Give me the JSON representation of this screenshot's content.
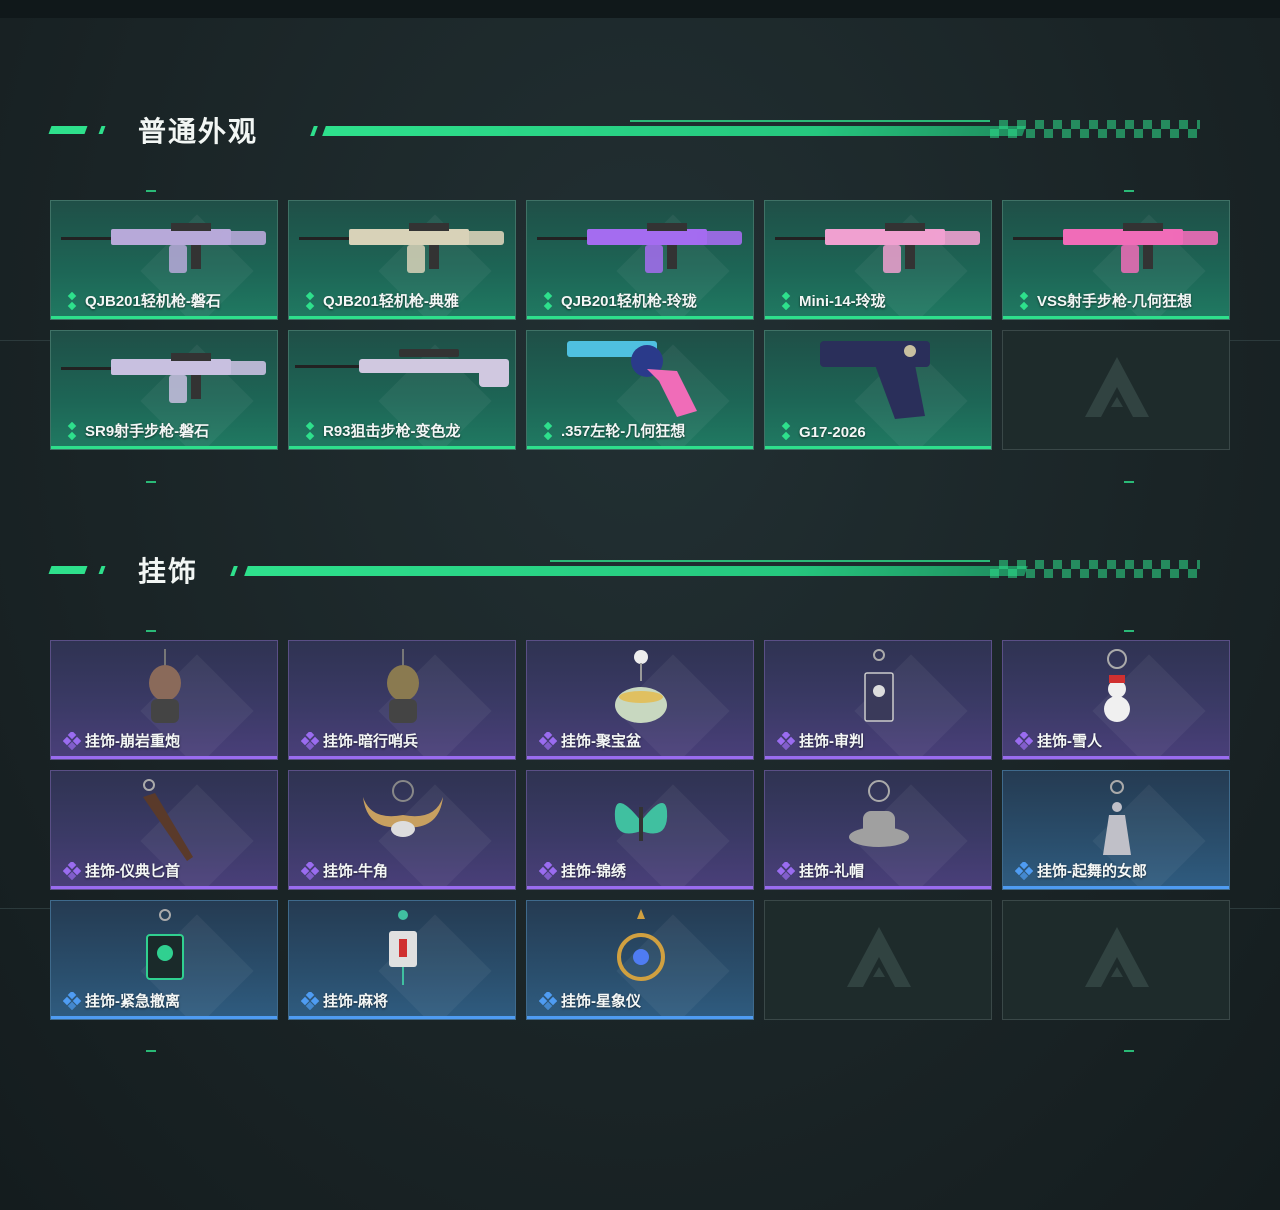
{
  "sections": [
    {
      "title": "普通外观",
      "items": [
        {
          "label": "QJB201轻机枪-磐石",
          "rarity": "green",
          "icon": "rifle-icon",
          "accent": "#b7a9d9"
        },
        {
          "label": "QJB201轻机枪-典雅",
          "rarity": "green",
          "icon": "rifle-icon",
          "accent": "#d8d2b8"
        },
        {
          "label": "QJB201轻机枪-玲珑",
          "rarity": "green",
          "icon": "rifle-icon",
          "accent": "#a46cf0"
        },
        {
          "label": "Mini-14-玲珑",
          "rarity": "green",
          "icon": "rifle-icon",
          "accent": "#f0a0d0"
        },
        {
          "label": "VSS射手步枪-几何狂想",
          "rarity": "green",
          "icon": "rifle-icon",
          "accent": "#f06cb8"
        },
        {
          "label": "SR9射手步枪-磐石",
          "rarity": "green",
          "icon": "rifle-icon",
          "accent": "#c8c0e0"
        },
        {
          "label": "R93狙击步枪-变色龙",
          "rarity": "green",
          "icon": "sniper-icon",
          "accent": "#d0c8e0"
        },
        {
          "label": ".357左轮-几何狂想",
          "rarity": "green",
          "icon": "revolver-icon",
          "accent": "#f06cb8"
        },
        {
          "label": "G17-2026",
          "rarity": "green",
          "icon": "pistol-icon",
          "accent": "#2a2f5a"
        },
        {
          "label": "",
          "rarity": "empty",
          "icon": "logo-icon",
          "accent": ""
        }
      ]
    },
    {
      "title": "挂饰",
      "items": [
        {
          "label": "挂饰-崩岩重炮",
          "rarity": "purple",
          "icon": "charm-figure-icon",
          "accent": "#8a6a5a"
        },
        {
          "label": "挂饰-暗行哨兵",
          "rarity": "purple",
          "icon": "charm-figure-icon",
          "accent": "#8a7a50"
        },
        {
          "label": "挂饰-聚宝盆",
          "rarity": "purple",
          "icon": "charm-bowl-icon",
          "accent": "#c8d8c0"
        },
        {
          "label": "挂饰-审判",
          "rarity": "purple",
          "icon": "charm-card-icon",
          "accent": "#3a3a5a"
        },
        {
          "label": "挂饰-雪人",
          "rarity": "purple",
          "icon": "charm-snowman-icon",
          "accent": "#f0f0f0"
        },
        {
          "label": "挂饰-仪典匕首",
          "rarity": "purple",
          "icon": "charm-dagger-icon",
          "accent": "#5a3a2a"
        },
        {
          "label": "挂饰-牛角",
          "rarity": "purple",
          "icon": "charm-horns-icon",
          "accent": "#c8a060"
        },
        {
          "label": "挂饰-锦绣",
          "rarity": "purple",
          "icon": "charm-butterfly-icon",
          "accent": "#40c0a0"
        },
        {
          "label": "挂饰-礼帽",
          "rarity": "purple",
          "icon": "charm-hat-icon",
          "accent": "#a0a0a0"
        },
        {
          "label": "挂饰-起舞的女郎",
          "rarity": "blue",
          "icon": "charm-dancer-icon",
          "accent": "#c0c0c8"
        },
        {
          "label": "挂饰-紧急撤离",
          "rarity": "blue",
          "icon": "charm-box-icon",
          "accent": "#30d090"
        },
        {
          "label": "挂饰-麻将",
          "rarity": "blue",
          "icon": "charm-mahjong-icon",
          "accent": "#e0e0e0"
        },
        {
          "label": "挂饰-星象仪",
          "rarity": "blue",
          "icon": "charm-astrolabe-icon",
          "accent": "#d0a040"
        },
        {
          "label": "",
          "rarity": "empty",
          "icon": "logo-icon",
          "accent": ""
        },
        {
          "label": "",
          "rarity": "empty",
          "icon": "logo-icon",
          "accent": ""
        }
      ]
    }
  ],
  "colors": {
    "green": "#2ee08c",
    "purple": "#9a6cf0",
    "blue": "#4f9cf2"
  }
}
